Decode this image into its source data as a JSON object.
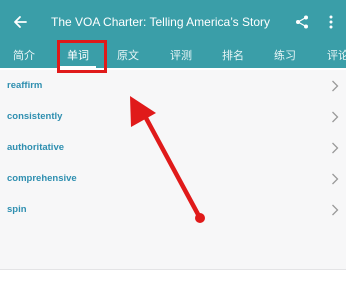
{
  "app_bar": {
    "title": "The VOA Charter: Telling America’s Story",
    "back_icon": "arrow-left-icon",
    "share_icon": "share-icon",
    "menu_icon": "more-vertical-icon",
    "background_color": "#3a9ea8"
  },
  "tabs": [
    {
      "label": "简介",
      "active": false
    },
    {
      "label": "单词",
      "active": true
    },
    {
      "label": "原文",
      "active": false
    },
    {
      "label": "评测",
      "active": false
    },
    {
      "label": "排名",
      "active": false
    },
    {
      "label": "练习",
      "active": false
    },
    {
      "label": "评论",
      "active": false
    }
  ],
  "word_list": [
    {
      "word": "reaffirm"
    },
    {
      "word": "consistently"
    },
    {
      "word": "authoritative"
    },
    {
      "word": "comprehensive"
    },
    {
      "word": "spin"
    }
  ],
  "annotation": {
    "color": "#e01a1a",
    "highlight_target": "单词"
  }
}
